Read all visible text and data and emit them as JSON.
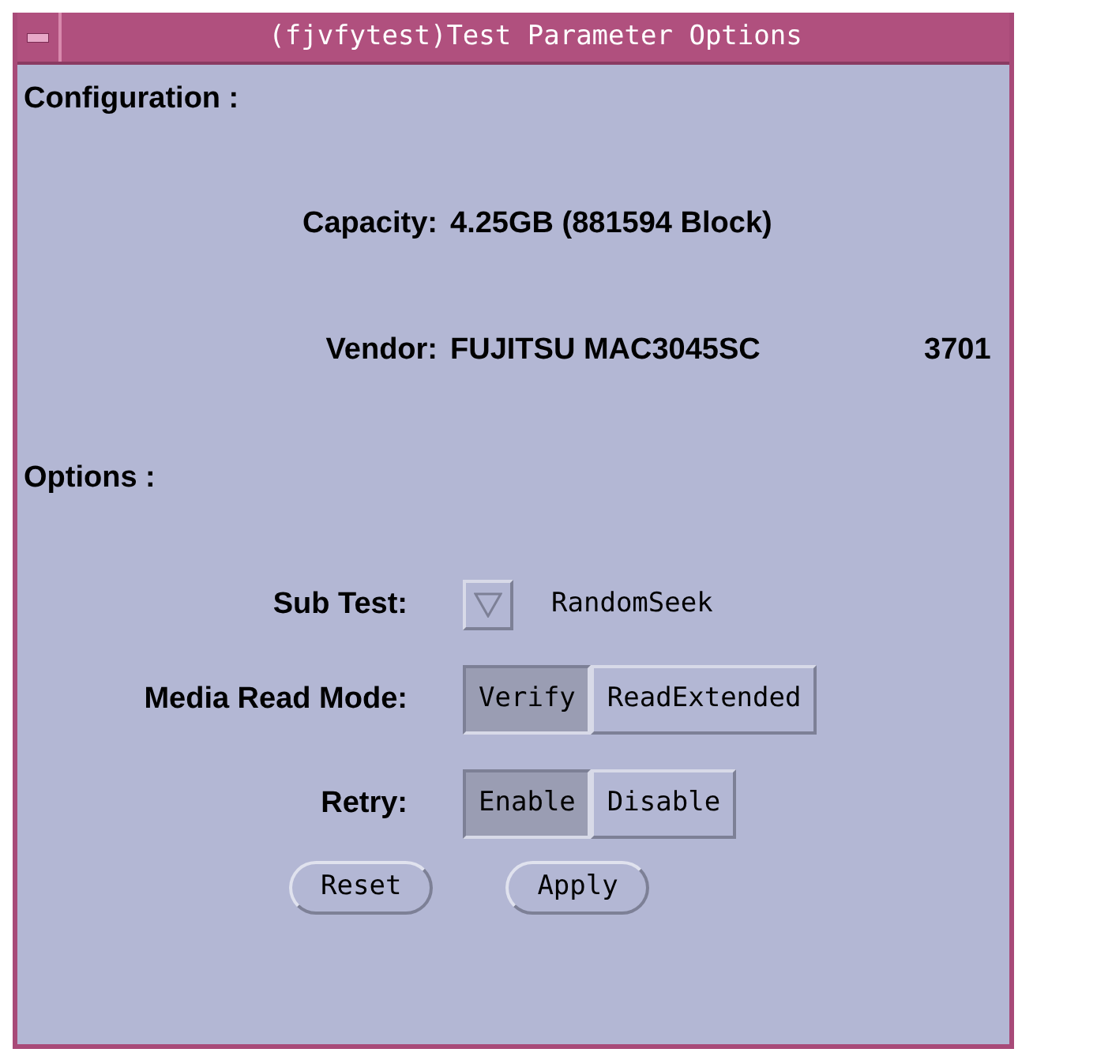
{
  "window": {
    "title": "(fjvfytest)Test Parameter Options"
  },
  "configuration": {
    "heading": "Configuration :",
    "fields": [
      {
        "label": "Capacity:",
        "value": "4.25GB (881594 Block)"
      },
      {
        "label": "Vendor:",
        "value": "FUJITSU MAC3045SC",
        "extra": "3701"
      }
    ]
  },
  "options": {
    "heading": "Options :",
    "rows": [
      {
        "kind": "dropdown",
        "label": "Sub Test:",
        "value": "RandomSeek"
      },
      {
        "kind": "exclusive",
        "label": "Media Read Mode:",
        "choices": [
          {
            "label": "Verify",
            "selected": true
          },
          {
            "label": "ReadExtended",
            "selected": false
          }
        ]
      },
      {
        "kind": "exclusive",
        "label": "Retry:",
        "choices": [
          {
            "label": "Enable",
            "selected": true
          },
          {
            "label": "Disable",
            "selected": false
          }
        ]
      }
    ]
  },
  "buttons": [
    "Reset",
    "Apply"
  ]
}
